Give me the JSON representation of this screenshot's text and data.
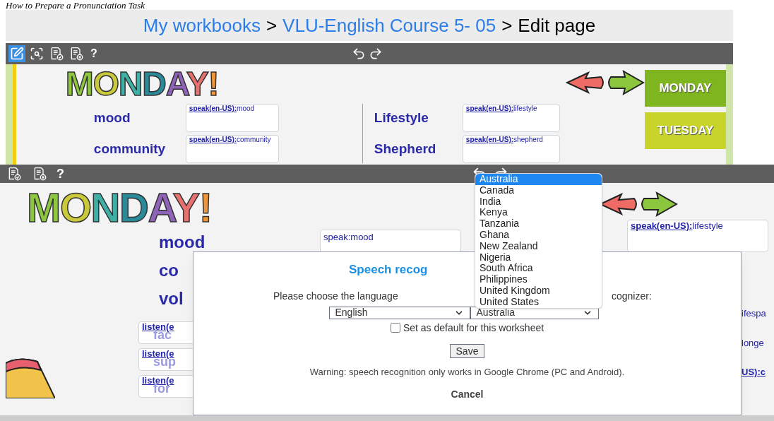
{
  "document_heading": "How to Prepare a Pronunciation Task",
  "top_screen": {
    "breadcrumb": [
      {
        "label": "My workbooks",
        "kind": "link"
      },
      {
        "separator": ">",
        "label": "VLU-English Course 5- 05",
        "kind": "link"
      },
      {
        "separator": ">",
        "label": "Edit page",
        "kind": "current"
      }
    ],
    "toolbar": {
      "tools": [
        {
          "kind": "edit",
          "selected": true
        },
        {
          "kind": "preview",
          "selected": false
        },
        {
          "kind": "check",
          "selected": false
        },
        {
          "kind": "clear",
          "selected": false
        }
      ],
      "help": "?"
    },
    "worksheet": {
      "title": "MONDAY!",
      "left_words": [
        {
          "word": "mood",
          "speak_tag": "speak(en-US):",
          "speak_word": "mood"
        },
        {
          "word": "community",
          "speak_tag": "speak(en-US):",
          "speak_word": "community"
        }
      ],
      "right_words": [
        {
          "word": "Lifestyle",
          "speak_tag": "speak(en-US):",
          "speak_word": "lifestyle"
        },
        {
          "word": "Shepherd",
          "speak_tag": "speak(en-US):",
          "speak_word": "shepherd"
        }
      ],
      "day_tabs": [
        "MONDAY",
        "TUESDAY"
      ]
    }
  },
  "bottom_screen": {
    "toolbar": {
      "tools": [
        {
          "kind": "check"
        },
        {
          "kind": "clear"
        }
      ],
      "help": "?"
    },
    "worksheet": {
      "title": "MONDAY!",
      "left_words": [
        "mood",
        "co",
        "vol"
      ],
      "speak_box": "speak:mood",
      "right_speak": {
        "tag": "speak(en-US):",
        "word": "lifestyle"
      },
      "listen_boxes": [
        {
          "tag": "listen(e",
          "faded_word": "fac"
        },
        {
          "tag": "listen(e",
          "faded_word": "sup"
        },
        {
          "tag": "listen(e",
          "faded_word": "for"
        }
      ],
      "right_edge_fragments": [
        {
          "text": "ifespa",
          "kind": "word"
        },
        {
          "text": "longe",
          "kind": "word"
        },
        {
          "text": "US):c",
          "kind": "tag"
        }
      ]
    },
    "dialog": {
      "title": "Speech recog",
      "prompt_start": "Please choose the language",
      "prompt_end": "cognizer:",
      "language_select": "English",
      "country_select": "Australia",
      "default_checkbox": {
        "label": "Set as default for this worksheet",
        "checked": false
      },
      "save_button": "Save",
      "warning": "Warning: speech recognition only works in Google Chrome (PC and Android).",
      "cancel": "Cancel"
    },
    "country_dropdown": [
      {
        "label": "Australia",
        "selected": true
      },
      {
        "label": "Canada",
        "selected": false
      },
      {
        "label": "India",
        "selected": false
      },
      {
        "label": "Kenya",
        "selected": false
      },
      {
        "label": "Tanzania",
        "selected": false
      },
      {
        "label": "Ghana",
        "selected": false
      },
      {
        "label": "New Zealand",
        "selected": false
      },
      {
        "label": "Nigeria",
        "selected": false
      },
      {
        "label": "South Africa",
        "selected": false
      },
      {
        "label": "Philippines",
        "selected": false
      },
      {
        "label": "United Kingdom",
        "selected": false
      },
      {
        "label": "United States",
        "selected": false
      }
    ]
  }
}
